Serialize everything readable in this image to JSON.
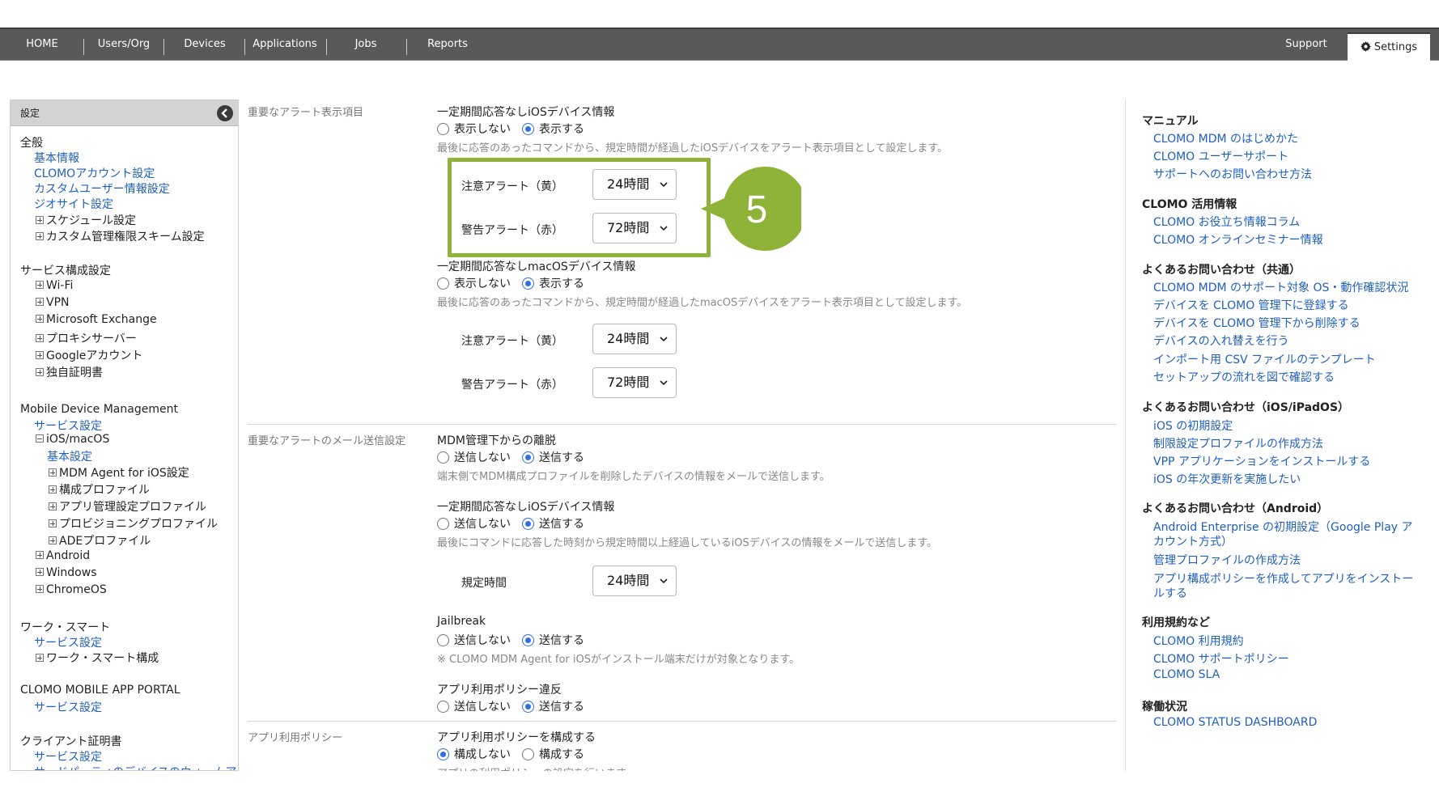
{
  "nav": {
    "items": [
      "HOME",
      "Users/Org",
      "Devices",
      "Applications",
      "Jobs",
      "Reports"
    ],
    "support": "Support",
    "settings": "Settings"
  },
  "sidebar": {
    "header": "設定",
    "g1_title": "全般",
    "g1_links": [
      "基本情報",
      "CLOMOアカウント設定",
      "カスタムユーザー情報設定",
      "ジオサイト設定"
    ],
    "g1_tree": [
      "スケジュール設定",
      "カスタム管理権限スキーム設定"
    ],
    "g2_title": "サービス構成設定",
    "g2_tree": [
      "Wi-Fi",
      "VPN",
      "Microsoft Exchange",
      "プロキシサーバー",
      "Googleアカウント",
      "独自証明書"
    ],
    "g3_title": "Mobile Device Management",
    "g3_link": "サービス設定",
    "g3_ios": "iOS/macOS",
    "g3_ios_link": "基本設定",
    "g3_ios_tree": [
      "MDM Agent for iOS設定",
      "構成プロファイル",
      "アプリ管理設定プロファイル",
      "プロビジョニングプロファイル",
      "ADEプロファイル"
    ],
    "g3_tree": [
      "Android",
      "Windows",
      "ChromeOS"
    ],
    "g4_title": "ワーク・スマート",
    "g4_link": "サービス設定",
    "g4_tree": "ワーク・スマート構成",
    "g5_title": "CLOMO MOBILE APP PORTAL",
    "g5_link": "サービス設定",
    "g6_title": "クライアント証明書",
    "g6_link": "サービス設定",
    "g6_partial": "サードパーティのデバイスのウォームアップ"
  },
  "main": {
    "sec1_label": "重要なアラート表示項目",
    "ios_title": "一定期間応答なしiOSデバイス情報",
    "show_off": "表示しない",
    "show_on": "表示する",
    "ios_desc": "最後に応答のあったコマンドから、規定時間が経過したiOSデバイスをアラート表示項目として設定します。",
    "caution_label": "注意アラート（黄）",
    "warning_label": "警告アラート（赤）",
    "val_24": "24時間",
    "val_72": "72時間",
    "mac_title": "一定期間応答なしmacOSデバイス情報",
    "mac_desc": "最後に応答のあったコマンドから、規定時間が経過したmacOSデバイスをアラート表示項目として設定します。",
    "sec2_label": "重要なアラートのメール送信設定",
    "mdm_title": "MDM管理下からの離脱",
    "send_off": "送信しない",
    "send_on": "送信する",
    "mdm_desc": "端末側でMDM構成プロファイルを削除したデバイスの情報をメールで送信します。",
    "ios2_title": "一定期間応答なしiOSデバイス情報",
    "ios2_desc": "最後にコマンドに応答した時刻から規定時間以上経過しているiOSデバイスの情報をメールで送信します。",
    "period_label": "規定時間",
    "jb_title": "Jailbreak",
    "jb_note": "※ CLOMO MDM Agent for iOSがインストール端末だけが対象となります。",
    "policy_title": "アプリ利用ポリシー違反",
    "sec3_label": "アプリ利用ポリシー",
    "policy_cfg_title": "アプリ利用ポリシーを構成する",
    "cfg_off": "構成しない",
    "cfg_on": "構成する",
    "policy_cfg_desc": "アプリの利用ポリシーの設定を行います。",
    "callout_number": "5"
  },
  "right": {
    "h1": "マニュアル",
    "l1": [
      "CLOMO MDM のはじめかた",
      "CLOMO ユーザーサポート",
      "サポートへのお問い合わせ方法"
    ],
    "h2": "CLOMO 活用情報",
    "l2": [
      "CLOMO お役立ち情報コラム",
      "CLOMO オンラインセミナー情報"
    ],
    "h3": "よくあるお問い合わせ（共通）",
    "l3": [
      "CLOMO MDM のサポート対象 OS・動作確認状況",
      "デバイスを CLOMO 管理下に登録する",
      "デバイスを CLOMO 管理下から削除する",
      "デバイスの入れ替えを行う",
      "インポート用 CSV ファイルのテンプレート",
      "セットアップの流れを図で確認する"
    ],
    "h4": "よくあるお問い合わせ（iOS/iPadOS）",
    "l4": [
      "iOS の初期設定",
      "制限設定プロファイルの作成方法",
      "VPP アプリケーションをインストールする",
      "iOS の年次更新を実施したい"
    ],
    "h5": "よくあるお問い合わせ（Android）",
    "l5": [
      "Android Enterprise の初期設定（Google Play ア",
      "カウント方式）",
      "管理プロファイルの作成方法",
      "アプリ構成ポリシーを作成してアプリをインストー",
      "ルする"
    ],
    "h6": "利用規約など",
    "l6": [
      "CLOMO 利用規約",
      "CLOMO サポートポリシー",
      "CLOMO SLA"
    ],
    "h7": "稼働状況",
    "l7": [
      "CLOMO STATUS DASHBOARD"
    ]
  },
  "colors": {
    "nav_bg": "#595959",
    "link": "#1f5fbf",
    "highlight": "#8fb339",
    "radio_selected": "#2f6fe0"
  }
}
